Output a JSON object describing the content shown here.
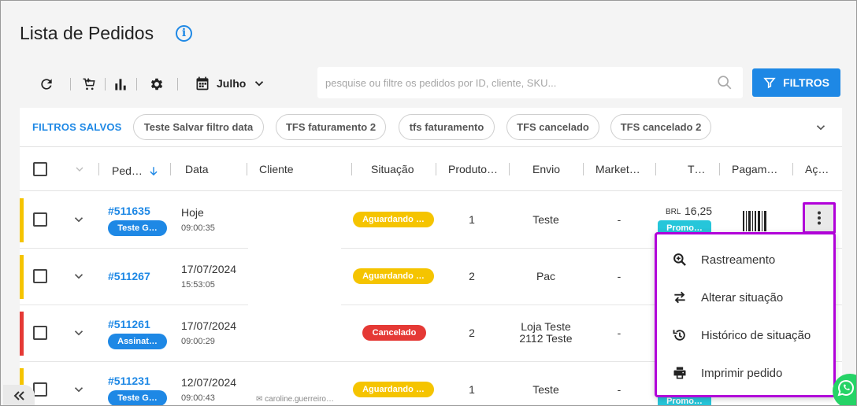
{
  "page": {
    "title": "Lista de Pedidos"
  },
  "toolbar": {
    "month_label": "Julho",
    "search_placeholder": "pesquise ou filtre os pedidos por ID, cliente, SKU...",
    "filters_label": "FILTROS"
  },
  "saved_filters": {
    "label": "FILTROS SALVOS",
    "chips": [
      "Teste Salvar filtro data",
      "TFS faturamento 2",
      "tfs faturamento",
      "TFS cancelado",
      "TFS cancelado 2"
    ]
  },
  "table": {
    "headers": {
      "pedido": "Ped…",
      "data": "Data",
      "cliente": "Cliente",
      "situacao": "Situação",
      "produtos": "Produto…",
      "envio": "Envio",
      "marketplace": "Market…",
      "total": "T…",
      "pagamento": "Pagam…",
      "acoes": "Aç…"
    },
    "rows": [
      {
        "id": "#511635",
        "tag": "Teste G…",
        "tag_color": "#1e88e5",
        "date": "Hoje",
        "time": "09:00:35",
        "status": "Aguardando …",
        "status_color": "#f5c400",
        "products": "1",
        "shipping": "Teste",
        "shipping2": "",
        "marketplace": "-",
        "bar_color": "#f5c400",
        "total_currency": "BRL",
        "total_value": "16,25",
        "promo": "Promo…",
        "client_note": ""
      },
      {
        "id": "#511267",
        "tag": "",
        "tag_color": "",
        "date": "17/07/2024",
        "time": "15:53:05",
        "status": "Aguardando …",
        "status_color": "#f5c400",
        "products": "2",
        "shipping": "Pac",
        "shipping2": "",
        "marketplace": "-",
        "bar_color": "#f5c400",
        "total_currency": "",
        "total_value": "",
        "promo": "",
        "client_note": ""
      },
      {
        "id": "#511261",
        "tag": "Assinat…",
        "tag_color": "#1e88e5",
        "date": "17/07/2024",
        "time": "09:00:29",
        "status": "Cancelado",
        "status_color": "#e53935",
        "products": "2",
        "shipping": "Loja Teste",
        "shipping2": "2112 Teste",
        "marketplace": "-",
        "bar_color": "#e53935",
        "total_currency": "",
        "total_value": "",
        "promo": "",
        "client_note": ""
      },
      {
        "id": "#511231",
        "tag": "Teste G…",
        "tag_color": "#1e88e5",
        "date": "12/07/2024",
        "time": "09:00:43",
        "status": "Aguardando …",
        "status_color": "#f5c400",
        "products": "1",
        "shipping": "Teste",
        "shipping2": "",
        "marketplace": "-",
        "bar_color": "#f5c400",
        "total_currency": "",
        "total_value": "",
        "promo": "Promo…",
        "client_note": "caroline.guerreiro…"
      }
    ]
  },
  "action_menu": {
    "items": [
      {
        "label": "Rastreamento",
        "icon": "zoom-in-icon"
      },
      {
        "label": "Alterar situação",
        "icon": "swap-arrows-icon"
      },
      {
        "label": "Histórico de situação",
        "icon": "history-icon"
      },
      {
        "label": "Imprimir pedido",
        "icon": "printer-icon"
      }
    ]
  },
  "colors": {
    "accent": "#1e88e5",
    "highlight": "#b100d9",
    "waiting": "#f5c400",
    "cancelled": "#e53935",
    "promo": "#26c6da"
  }
}
